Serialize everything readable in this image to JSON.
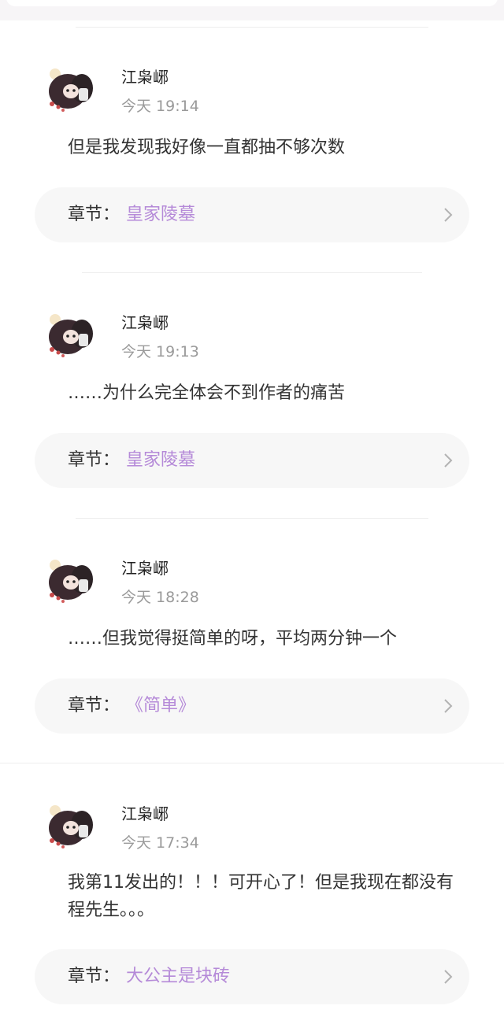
{
  "comments": [
    {
      "author": "江枭峫",
      "time": "今天 19:14",
      "content": "但是我发现我好像一直都抽不够次数",
      "chapter_label": "章节：",
      "chapter_name": "皇家陵墓"
    },
    {
      "author": "江枭峫",
      "time": "今天 19:13",
      "content": "……为什么完全体会不到作者的痛苦",
      "chapter_label": "章节：",
      "chapter_name": "皇家陵墓"
    },
    {
      "author": "江枭峫",
      "time": "今天 18:28",
      "content": "……但我觉得挺简单的呀，平均两分钟一个",
      "chapter_label": "章节：",
      "chapter_name": "《简单》"
    },
    {
      "author": "江枭峫",
      "time": "今天 17:34",
      "content": "我第11发出的！！！可开心了！但是我现在都没有程先生。。。",
      "chapter_label": "章节：",
      "chapter_name": "大公主是块砖"
    }
  ],
  "icons": {
    "chevron": "chevron-right-icon",
    "avatar": "avatar"
  },
  "colors": {
    "accent": "#b58ad8",
    "muted": "#9a9a9a",
    "card": "#f7f7f7"
  }
}
